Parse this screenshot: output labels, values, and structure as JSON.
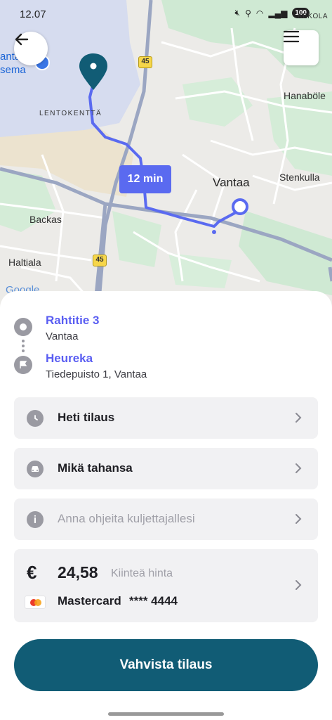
{
  "status_bar": {
    "time": "12.07",
    "battery": "100",
    "right_text": "KEKOLA"
  },
  "map": {
    "labels": {
      "airport": "LENTOKENTTÄ",
      "vantaa": "Vantaa",
      "hanaboele": "Hanaböle",
      "stenkulla": "Stenkulla",
      "backas": "Backas",
      "haltiala": "Haltiala",
      "station_line1": "anta",
      "station_line2": "sema",
      "google": "Google"
    },
    "highway_numbers": [
      "45",
      "45"
    ],
    "eta": "12 min",
    "route_color": "#5a6af0",
    "pin_color": "#115c75"
  },
  "route": {
    "pickup": {
      "name": "Rahtitie 3",
      "city": "Vantaa"
    },
    "destination": {
      "name": "Heureka",
      "address": "Tiedepuisto 1, Vantaa"
    }
  },
  "options": {
    "time": "Heti tilaus",
    "vehicle": "Mikä tahansa",
    "driver_note_placeholder": "Anna ohjeita kuljettajallesi"
  },
  "payment": {
    "currency_symbol": "€",
    "price": "24,58",
    "price_type": "Kiinteä hinta",
    "card_name": "Mastercard",
    "card_number": "**** 4444"
  },
  "confirm_button": "Vahvista tilaus",
  "colors": {
    "accent": "#5a5ef2",
    "primary_button": "#115c75",
    "card_bg": "#f1f1f3"
  }
}
